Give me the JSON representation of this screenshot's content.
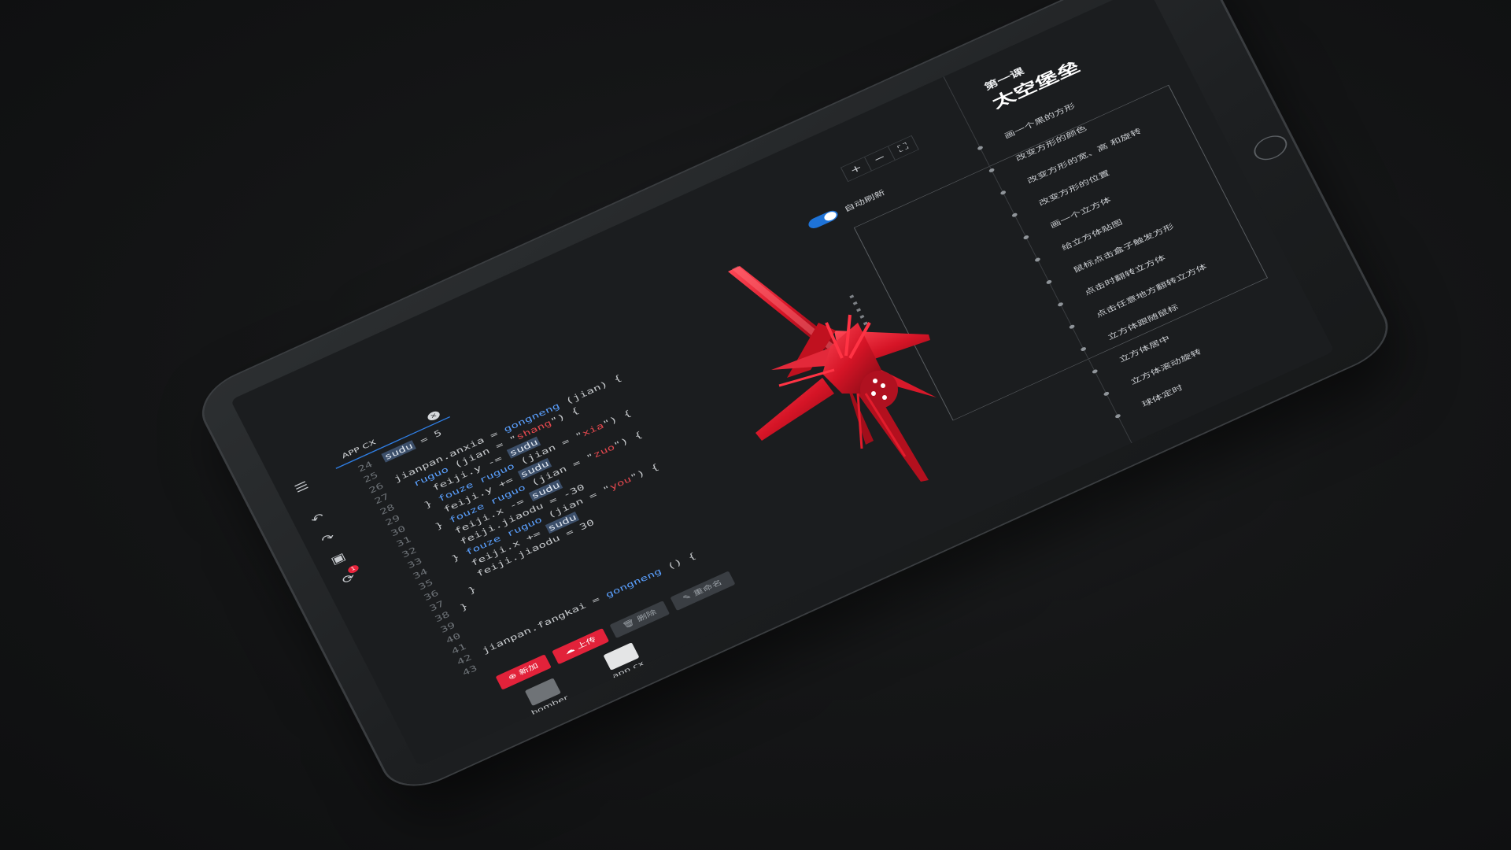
{
  "toolbar": {
    "menu_icon": "menu-icon",
    "undo_icon": "undo-icon",
    "redo_icon": "redo-icon",
    "save_icon": "save-icon",
    "sync_icon": "sync-icon",
    "sync_badge": "1"
  },
  "tab": {
    "label": "APP CX",
    "close_icon": "close-icon"
  },
  "code": {
    "lines": [
      {
        "n": "24",
        "t": "sudu = 5"
      },
      {
        "n": "25",
        "t": ""
      },
      {
        "n": "26",
        "t": "jianpan.anxia = gongneng (jian) {"
      },
      {
        "n": "27",
        "t": "  ruguo (jian = \"shang\") {"
      },
      {
        "n": "28",
        "t": "    feiji.y -= sudu"
      },
      {
        "n": "29",
        "t": "  } fouze ruguo (jian = \"xia\") {"
      },
      {
        "n": "30",
        "t": "    feiji.y += sudu"
      },
      {
        "n": "31",
        "t": "  } fouze ruguo (jian = \"zuo\") {"
      },
      {
        "n": "32",
        "t": "    feiji.x -= sudu"
      },
      {
        "n": "33",
        "t": "    feiji.jiaodu = -30"
      },
      {
        "n": "34",
        "t": "  } fouze ruguo (jian = \"you\") {"
      },
      {
        "n": "35",
        "t": "    feiji.x += sudu"
      },
      {
        "n": "36",
        "t": "    feiji.jiaodu = 30"
      },
      {
        "n": "37",
        "t": "  }"
      },
      {
        "n": "38",
        "t": "}"
      },
      {
        "n": "39",
        "t": ""
      },
      {
        "n": "40",
        "t": ""
      },
      {
        "n": "41",
        "t": ""
      },
      {
        "n": "42",
        "t": "jianpan.fangkai = gongneng () {"
      },
      {
        "n": "43",
        "t": ""
      }
    ]
  },
  "actions": {
    "add": "新加",
    "upload": "上传",
    "delete": "删除",
    "rename": "重命名"
  },
  "files": [
    {
      "name": "bomber",
      "kind": "folder-icon"
    },
    {
      "name": "app cx",
      "kind": "file-icon"
    }
  ],
  "auto_refresh": {
    "label": "自动刷新",
    "on": true
  },
  "zoom": {
    "plus": "+",
    "minus": "−",
    "fullscreen": "⛶"
  },
  "lesson": {
    "subtitle": "第一课",
    "title": "太空堡垒",
    "steps": [
      "画一个黑的方形",
      "改变方形的颜色",
      "改变方形的宽、高 和旋转",
      "改变方形的位置",
      "画一个立方体",
      "给立方体贴图",
      "鼠标点击盒子触发方形",
      "点击时翻转立方体",
      "点击任意地方翻转立方体",
      "立方体跟随鼠标",
      "立方体居中",
      "立方体滚动旋转",
      "球体定时"
    ]
  },
  "colors": {
    "accent_red": "#e2223a",
    "accent_blue": "#1e73d8",
    "keyword": "#5aa0ff"
  }
}
